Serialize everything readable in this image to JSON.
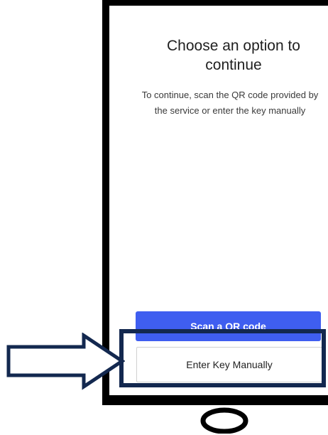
{
  "screen": {
    "title": "Choose an option to continue",
    "description": "To continue, scan the QR code provided by the service or enter the key manually"
  },
  "actions": {
    "scan_label": "Scan a QR code",
    "manual_label": "Enter Key Manually"
  },
  "colors": {
    "primary_button": "#3f5ef0",
    "highlight_border": "#13284f",
    "arrow_stroke": "#13284f",
    "device_frame": "#000000"
  },
  "icons": {
    "pointer": "right-arrow-icon",
    "home": "home-button-icon"
  }
}
